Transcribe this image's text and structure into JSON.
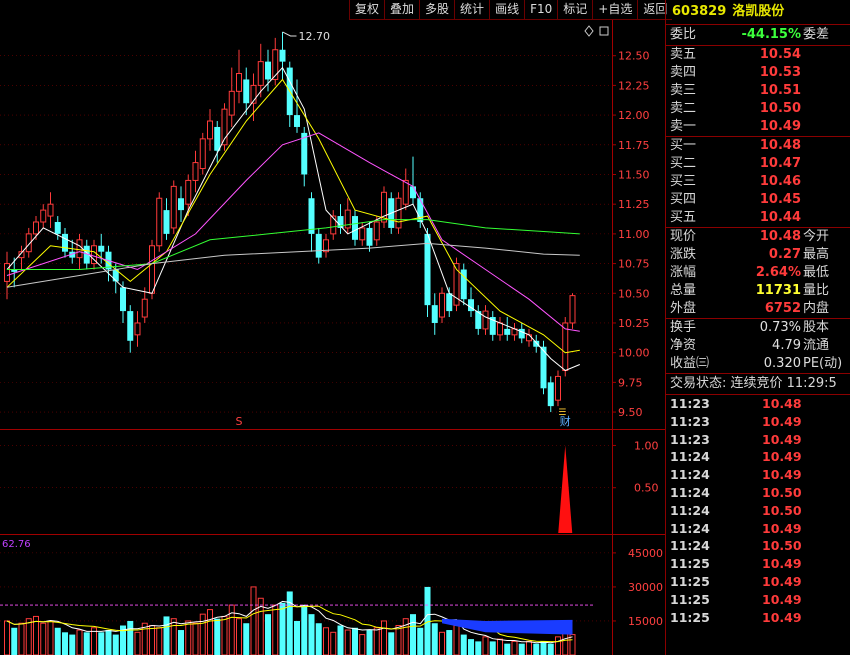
{
  "toolbar": [
    "复权",
    "叠加",
    "多股",
    "统计",
    "画线",
    "F10",
    "标记",
    "+自选",
    "返回"
  ],
  "colors": {
    "up": "#ff3b3b",
    "down": "#54ffff",
    "ma5": "#ffffff",
    "ma10": "#ffff00",
    "ma20": "#ff55ff",
    "ma30": "#33ff33",
    "ma60": "#c8c8c8",
    "grid": "#7a0000"
  },
  "stock": {
    "code": "603829",
    "name": "洛凯股份"
  },
  "orderbook": {
    "ratio_label": "委比",
    "ratio_value": "-44.15%",
    "diff_label": "委差",
    "asks": [
      {
        "label": "卖五",
        "price": "10.54"
      },
      {
        "label": "卖四",
        "price": "10.53"
      },
      {
        "label": "卖三",
        "price": "10.51"
      },
      {
        "label": "卖二",
        "price": "10.50"
      },
      {
        "label": "卖一",
        "price": "10.49"
      }
    ],
    "bids": [
      {
        "label": "买一",
        "price": "10.48"
      },
      {
        "label": "买二",
        "price": "10.47"
      },
      {
        "label": "买三",
        "price": "10.46"
      },
      {
        "label": "买四",
        "price": "10.45"
      },
      {
        "label": "买五",
        "price": "10.44"
      }
    ]
  },
  "quote": [
    {
      "label": "现价",
      "value": "10.48",
      "label2": "今开",
      "color": "red"
    },
    {
      "label": "涨跌",
      "value": "0.27",
      "label2": "最高",
      "color": "red"
    },
    {
      "label": "涨幅",
      "value": "2.64%",
      "label2": "最低",
      "color": "red"
    },
    {
      "label": "总量",
      "value": "11731",
      "label2": "量比",
      "color": "yellow"
    },
    {
      "label": "外盘",
      "value": "6752",
      "label2": "内盘",
      "color": "red"
    }
  ],
  "stats": [
    {
      "label": "换手",
      "value": "0.73%",
      "label2": "股本"
    },
    {
      "label": "净资",
      "value": "4.79",
      "label2": "流通"
    },
    {
      "label": "收益㈢",
      "value": "0.320",
      "label2": "PE(动)"
    }
  ],
  "trade_state": "交易状态: 连续竞价 11:29:5",
  "ticks": [
    {
      "t": "11:23",
      "p": "10.48"
    },
    {
      "t": "11:23",
      "p": "10.49"
    },
    {
      "t": "11:23",
      "p": "10.49"
    },
    {
      "t": "11:24",
      "p": "10.49"
    },
    {
      "t": "11:24",
      "p": "10.49"
    },
    {
      "t": "11:24",
      "p": "10.50"
    },
    {
      "t": "11:24",
      "p": "10.50"
    },
    {
      "t": "11:24",
      "p": "10.49"
    },
    {
      "t": "11:24",
      "p": "10.50"
    },
    {
      "t": "11:25",
      "p": "10.49"
    },
    {
      "t": "11:25",
      "p": "10.49"
    },
    {
      "t": "11:25",
      "p": "10.49"
    },
    {
      "t": "11:25",
      "p": "10.49"
    }
  ],
  "chart_data": {
    "price_axis": {
      "ticks": [
        "12.50",
        "12.25",
        "12.00",
        "11.75",
        "11.50",
        "11.25",
        "11.00",
        "10.75",
        "10.50",
        "10.25",
        "10.00",
        "9.75",
        "9.50"
      ],
      "ylim": [
        9.45,
        12.75
      ]
    },
    "high_label": "12.70",
    "candles": [
      [
        10.6,
        10.75,
        10.85,
        10.45
      ],
      [
        10.7,
        10.68,
        10.8,
        10.55
      ],
      [
        10.8,
        10.85,
        10.9,
        10.7
      ],
      [
        10.85,
        11.0,
        11.05,
        10.8
      ],
      [
        11.0,
        11.1,
        11.15,
        10.95
      ],
      [
        11.1,
        11.2,
        11.25,
        11.05
      ],
      [
        11.15,
        11.25,
        11.35,
        11.05
      ],
      [
        11.1,
        11.0,
        11.15,
        10.95
      ],
      [
        11.0,
        10.85,
        11.05,
        10.8
      ],
      [
        10.85,
        10.8,
        10.95,
        10.75
      ],
      [
        10.8,
        10.95,
        11.0,
        10.7
      ],
      [
        10.9,
        10.75,
        10.95,
        10.7
      ],
      [
        10.75,
        10.9,
        10.95,
        10.7
      ],
      [
        10.9,
        10.85,
        11.0,
        10.75
      ],
      [
        10.85,
        10.7,
        10.9,
        10.6
      ],
      [
        10.7,
        10.6,
        10.75,
        10.5
      ],
      [
        10.55,
        10.35,
        10.6,
        10.25
      ],
      [
        10.35,
        10.1,
        10.4,
        10.0
      ],
      [
        10.15,
        10.25,
        10.35,
        10.05
      ],
      [
        10.3,
        10.45,
        10.55,
        10.25
      ],
      [
        10.5,
        10.9,
        10.95,
        10.45
      ],
      [
        10.9,
        11.3,
        11.35,
        10.85
      ],
      [
        11.2,
        11.0,
        11.3,
        10.95
      ],
      [
        11.05,
        11.4,
        11.45,
        11.0
      ],
      [
        11.3,
        11.2,
        11.4,
        11.1
      ],
      [
        11.25,
        11.45,
        11.5,
        11.15
      ],
      [
        11.45,
        11.6,
        11.7,
        11.35
      ],
      [
        11.55,
        11.8,
        11.85,
        11.5
      ],
      [
        11.8,
        11.95,
        12.05,
        11.7
      ],
      [
        11.9,
        11.7,
        11.95,
        11.6
      ],
      [
        11.75,
        12.05,
        12.1,
        11.7
      ],
      [
        12.0,
        12.2,
        12.4,
        11.9
      ],
      [
        12.2,
        12.35,
        12.55,
        12.1
      ],
      [
        12.3,
        12.1,
        12.4,
        12.0
      ],
      [
        12.1,
        12.25,
        12.35,
        11.95
      ],
      [
        12.25,
        12.45,
        12.6,
        12.15
      ],
      [
        12.45,
        12.3,
        12.55,
        12.2
      ],
      [
        12.3,
        12.55,
        12.65,
        12.25
      ],
      [
        12.55,
        12.45,
        12.7,
        12.3
      ],
      [
        12.4,
        12.0,
        12.45,
        11.9
      ],
      [
        12.0,
        11.9,
        12.3,
        11.85
      ],
      [
        11.85,
        11.5,
        11.9,
        11.4
      ],
      [
        11.3,
        11.0,
        11.35,
        10.85
      ],
      [
        11.0,
        10.8,
        11.05,
        10.75
      ],
      [
        10.85,
        10.95,
        11.0,
        10.8
      ],
      [
        11.0,
        11.15,
        11.2,
        10.95
      ],
      [
        11.15,
        11.05,
        11.25,
        11.0
      ],
      [
        11.05,
        11.2,
        11.3,
        11.0
      ],
      [
        11.15,
        10.95,
        11.2,
        10.9
      ],
      [
        10.95,
        11.05,
        11.1,
        10.9
      ],
      [
        11.05,
        10.9,
        11.1,
        10.85
      ],
      [
        10.95,
        11.1,
        11.15,
        10.9
      ],
      [
        11.1,
        11.35,
        11.4,
        11.05
      ],
      [
        11.3,
        11.05,
        11.35,
        11.0
      ],
      [
        11.05,
        11.3,
        11.35,
        11.0
      ],
      [
        11.25,
        11.45,
        11.55,
        11.2
      ],
      [
        11.4,
        11.3,
        11.65,
        11.25
      ],
      [
        11.3,
        11.1,
        11.35,
        11.05
      ],
      [
        11.0,
        10.4,
        11.05,
        10.3
      ],
      [
        10.4,
        10.25,
        10.5,
        10.15
      ],
      [
        10.3,
        10.5,
        10.55,
        10.25
      ],
      [
        10.5,
        10.35,
        10.55,
        10.3
      ],
      [
        10.4,
        10.75,
        10.8,
        10.35
      ],
      [
        10.7,
        10.45,
        10.75,
        10.4
      ],
      [
        10.45,
        10.35,
        10.55,
        10.3
      ],
      [
        10.35,
        10.2,
        10.4,
        10.15
      ],
      [
        10.2,
        10.35,
        10.4,
        10.15
      ],
      [
        10.3,
        10.15,
        10.35,
        10.1
      ],
      [
        10.15,
        10.25,
        10.3,
        10.1
      ],
      [
        10.2,
        10.15,
        10.3,
        10.1
      ],
      [
        10.15,
        10.2,
        10.25,
        10.1
      ],
      [
        10.2,
        10.12,
        10.25,
        10.08
      ],
      [
        10.1,
        10.15,
        10.2,
        10.05
      ],
      [
        10.1,
        10.05,
        10.15,
        10.0
      ],
      [
        10.05,
        9.7,
        10.1,
        9.65
      ],
      [
        9.75,
        9.55,
        9.8,
        9.5
      ],
      [
        9.6,
        9.8,
        9.85,
        9.55
      ],
      [
        9.85,
        10.25,
        10.3,
        9.8
      ],
      [
        10.25,
        10.48,
        10.5,
        10.2
      ]
    ],
    "ma_lines": [
      {
        "name": "ma5",
        "color": "#ffffff",
        "points": [
          [
            0,
            10.7
          ],
          [
            5,
            11.05
          ],
          [
            10,
            10.9
          ],
          [
            16,
            10.55
          ],
          [
            20,
            10.5
          ],
          [
            25,
            11.2
          ],
          [
            30,
            11.8
          ],
          [
            35,
            12.2
          ],
          [
            38,
            12.4
          ],
          [
            41,
            12.05
          ],
          [
            44,
            11.2
          ],
          [
            47,
            11.0
          ],
          [
            52,
            11.15
          ],
          [
            56,
            11.25
          ],
          [
            58,
            11.0
          ],
          [
            61,
            10.5
          ],
          [
            66,
            10.3
          ],
          [
            72,
            10.15
          ],
          [
            75,
            9.95
          ],
          [
            77,
            9.85
          ],
          [
            79,
            9.9
          ]
        ]
      },
      {
        "name": "ma10",
        "color": "#ffff00",
        "points": [
          [
            0,
            10.55
          ],
          [
            6,
            10.9
          ],
          [
            12,
            10.85
          ],
          [
            17,
            10.6
          ],
          [
            22,
            10.85
          ],
          [
            28,
            11.5
          ],
          [
            33,
            11.95
          ],
          [
            38,
            12.3
          ],
          [
            43,
            11.8
          ],
          [
            48,
            11.2
          ],
          [
            54,
            11.1
          ],
          [
            58,
            11.15
          ],
          [
            62,
            10.7
          ],
          [
            68,
            10.35
          ],
          [
            74,
            10.15
          ],
          [
            77,
            10.0
          ],
          [
            79,
            10.02
          ]
        ]
      },
      {
        "name": "ma20",
        "color": "#ff55ff",
        "points": [
          [
            0,
            10.65
          ],
          [
            10,
            10.85
          ],
          [
            18,
            10.7
          ],
          [
            26,
            11.0
          ],
          [
            33,
            11.45
          ],
          [
            38,
            11.75
          ],
          [
            43,
            11.85
          ],
          [
            50,
            11.6
          ],
          [
            56,
            11.4
          ],
          [
            60,
            10.95
          ],
          [
            66,
            10.7
          ],
          [
            72,
            10.45
          ],
          [
            77,
            10.2
          ],
          [
            79,
            10.18
          ]
        ]
      },
      {
        "name": "ma30",
        "color": "#33ff33",
        "points": [
          [
            0,
            10.7
          ],
          [
            10,
            10.7
          ],
          [
            20,
            10.75
          ],
          [
            28,
            10.95
          ],
          [
            36,
            11.0
          ],
          [
            44,
            11.05
          ],
          [
            52,
            11.12
          ],
          [
            58,
            11.12
          ],
          [
            66,
            11.05
          ],
          [
            74,
            11.02
          ],
          [
            79,
            11.0
          ]
        ]
      },
      {
        "name": "ma60",
        "color": "#c8c8c8",
        "points": [
          [
            0,
            10.55
          ],
          [
            10,
            10.65
          ],
          [
            20,
            10.75
          ],
          [
            30,
            10.82
          ],
          [
            40,
            10.85
          ],
          [
            50,
            10.88
          ],
          [
            58,
            10.92
          ],
          [
            66,
            10.88
          ],
          [
            74,
            10.83
          ],
          [
            79,
            10.82
          ]
        ]
      }
    ],
    "markers": [
      {
        "text": "S",
        "x": 32
      },
      {
        "text": "财",
        "x": 77
      }
    ],
    "indicator": {
      "axis": [
        "1.00",
        "0.50"
      ],
      "spike_at": 77,
      "spike_value": 1.0
    },
    "volume": {
      "label": "62.76",
      "axis": [
        "45000",
        "30000",
        "15000"
      ],
      "ylim": [
        0,
        52000
      ],
      "values": [
        15000,
        12000,
        14000,
        16000,
        17000,
        14000,
        15000,
        12000,
        10000,
        9000,
        11000,
        10000,
        12000,
        10000,
        11000,
        9000,
        13000,
        15000,
        10000,
        14000,
        13000,
        12000,
        17000,
        16000,
        11000,
        15000,
        14000,
        18000,
        20000,
        16000,
        17000,
        22000,
        16000,
        14000,
        30000,
        25000,
        18000,
        22000,
        23000,
        28000,
        15000,
        22000,
        18000,
        14000,
        12000,
        10000,
        13000,
        11000,
        12000,
        9000,
        11000,
        12000,
        15000,
        10000,
        13000,
        16000,
        18000,
        12000,
        30000,
        14000,
        10000,
        11000,
        13000,
        9000,
        7000,
        6000,
        8000,
        6000,
        7000,
        5000,
        6000,
        5000,
        6000,
        5000,
        6000,
        5000,
        8000,
        12000,
        9000
      ]
    }
  }
}
